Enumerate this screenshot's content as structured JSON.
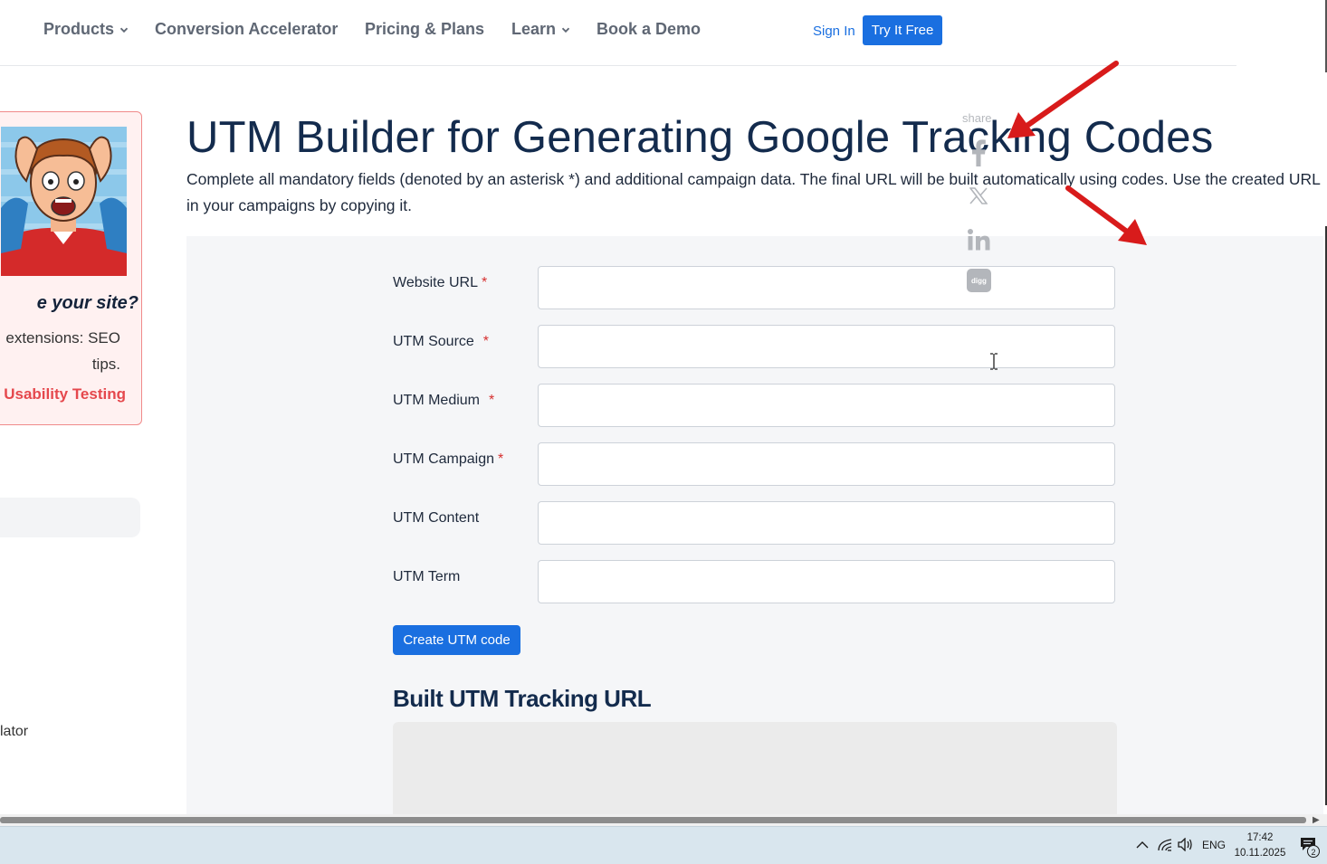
{
  "nav": {
    "items": [
      {
        "label": "Products",
        "dropdown": true
      },
      {
        "label": "Conversion Accelerator",
        "dropdown": false
      },
      {
        "label": "Pricing & Plans",
        "dropdown": false
      },
      {
        "label": "Learn",
        "dropdown": true
      },
      {
        "label": "Book a Demo",
        "dropdown": false
      }
    ],
    "sign_in": "Sign In",
    "try_free": "Try It Free"
  },
  "promo": {
    "title": "e your site?",
    "text_line1": "extensions: SEO",
    "text_line2": "tips.",
    "link": "Usability Testing",
    "side_link": "lator"
  },
  "page": {
    "title": "UTM Builder for Generating Google Tracking Codes",
    "description": "Complete all mandatory fields (denoted by an asterisk *) and additional campaign data. The final URL will be built automatically using codes. Use the created URL in your campaigns by copying it."
  },
  "form": {
    "fields": [
      {
        "label": "Website URL",
        "required": true,
        "value": ""
      },
      {
        "label": "UTM Source",
        "required": true,
        "value": ""
      },
      {
        "label": "UTM Medium",
        "required": true,
        "value": ""
      },
      {
        "label": "UTM Campaign",
        "required": true,
        "value": ""
      },
      {
        "label": "UTM Content",
        "required": false,
        "value": ""
      },
      {
        "label": "UTM Term",
        "required": false,
        "value": ""
      }
    ],
    "required_mark": "*",
    "submit_label": "Create UTM code",
    "result_title": "Built UTM Tracking URL",
    "result_value": ""
  },
  "share": {
    "label": "share",
    "icons": [
      "facebook-icon",
      "x-twitter-icon",
      "linkedin-icon",
      "digg-icon"
    ],
    "digg_text": "digg"
  },
  "taskbar": {
    "language": "ENG",
    "time": "17:42",
    "date": "10.11.2025",
    "notification_count": "2"
  },
  "colors": {
    "accent": "#1a6fe0",
    "title": "#132b4d",
    "required": "#d62f2f",
    "promo_link": "#e5484d",
    "arrow": "#d81b1b"
  }
}
